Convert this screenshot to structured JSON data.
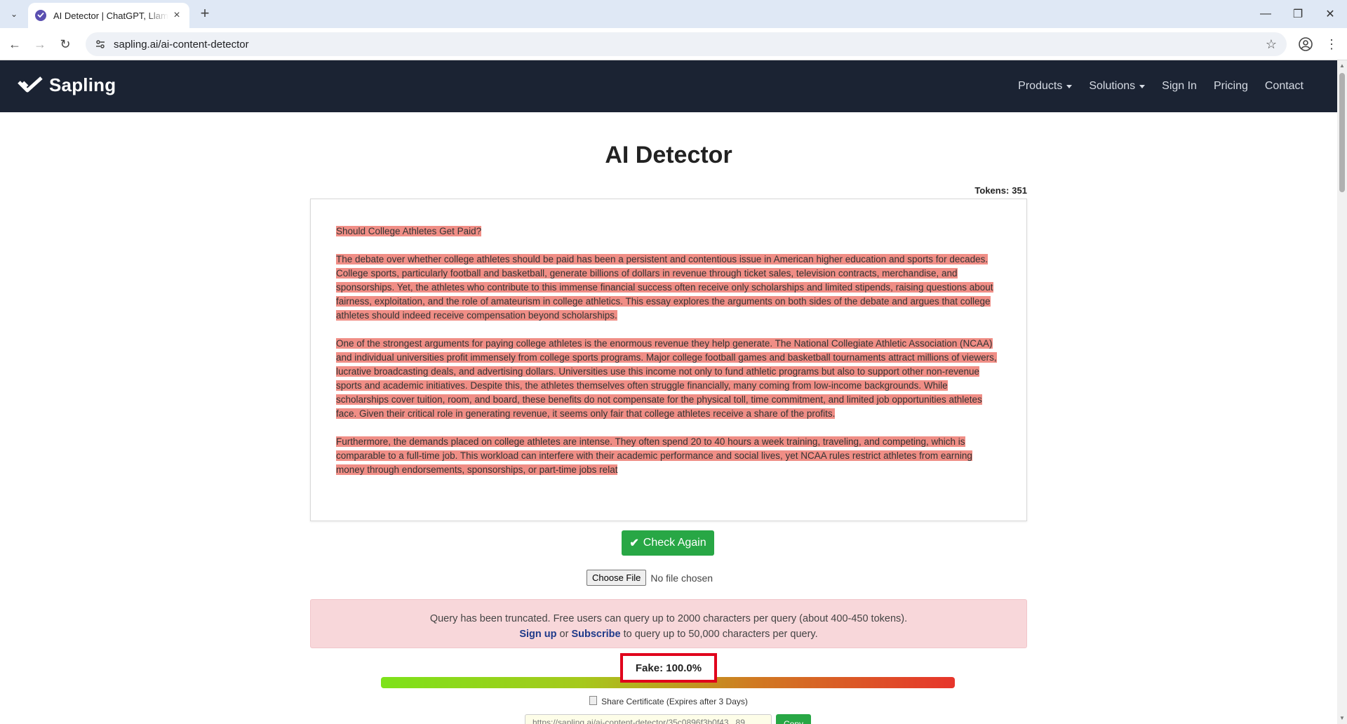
{
  "browser": {
    "tab_title": "AI Detector | ChatGPT, Llama",
    "url": "sapling.ai/ai-content-detector"
  },
  "nav": {
    "brand": "Sapling",
    "links": [
      "Products",
      "Solutions",
      "Sign In",
      "Pricing",
      "Contact"
    ]
  },
  "page": {
    "title": "AI Detector",
    "tokens_label": "Tokens:",
    "tokens_value": "351"
  },
  "text": {
    "paragraphs": [
      "Should College Athletes Get Paid?",
      "The debate over whether college athletes should be paid has been a persistent and contentious issue in American higher education and sports for decades. College sports, particularly football and basketball, generate billions of dollars in revenue through ticket sales, television contracts, merchandise, and sponsorships. Yet, the athletes who contribute to this immense financial success often receive only scholarships and limited stipends, raising questions about fairness, exploitation, and the role of amateurism in college athletics. This essay explores the arguments on both sides of the debate and argues that college athletes should indeed receive compensation beyond scholarships.",
      "One of the strongest arguments for paying college athletes is the enormous revenue they help generate. The National Collegiate Athletic Association (NCAA) and individual universities profit immensely from college sports programs. Major college football games and basketball tournaments attract millions of viewers, lucrative broadcasting deals, and advertising dollars. Universities use this income not only to fund athletic programs but also to support other non-revenue sports and academic initiatives. Despite this, the athletes themselves often struggle financially, many coming from low-income backgrounds. While scholarships cover tuition, room, and board, these benefits do not compensate for the physical toll, time commitment, and limited job opportunities athletes face. Given their critical role in generating revenue, it seems only fair that college athletes receive a share of the profits.",
      "Furthermore, the demands placed on college athletes are intense. They often spend 20 to 40 hours a week training, traveling, and competing, which is comparable to a full-time job. This workload can interfere with their academic performance and social lives, yet NCAA rules restrict athletes from earning money through endorsements, sponsorships, or part-time jobs relat"
    ],
    "highlight_color": "#f08e86"
  },
  "actions": {
    "check_again": "Check Again",
    "choose_file": "Choose File",
    "file_status": "No file chosen"
  },
  "alert": {
    "line1": "Query has been truncated. Free users can query up to 2000 characters per query (about 400-450 tokens).",
    "signup": "Sign up",
    "or": "or",
    "subscribe": "Subscribe",
    "line2_rest": "to query up to 50,000 characters per query."
  },
  "result": {
    "fake_label": "Fake: 100.0%",
    "fake_fraction": 1.0,
    "share_label": "Share Certificate (Expires after 3 Days)",
    "share_url": "https://sapling.ai/ai-content-detector/35c0896f3b0f43...89",
    "copy_label": "Copy"
  },
  "colors": {
    "nav_bg": "#1b2333",
    "button_green": "#28a745",
    "alert_bg": "#f8d7da",
    "highlight_box": "#e0001b"
  }
}
